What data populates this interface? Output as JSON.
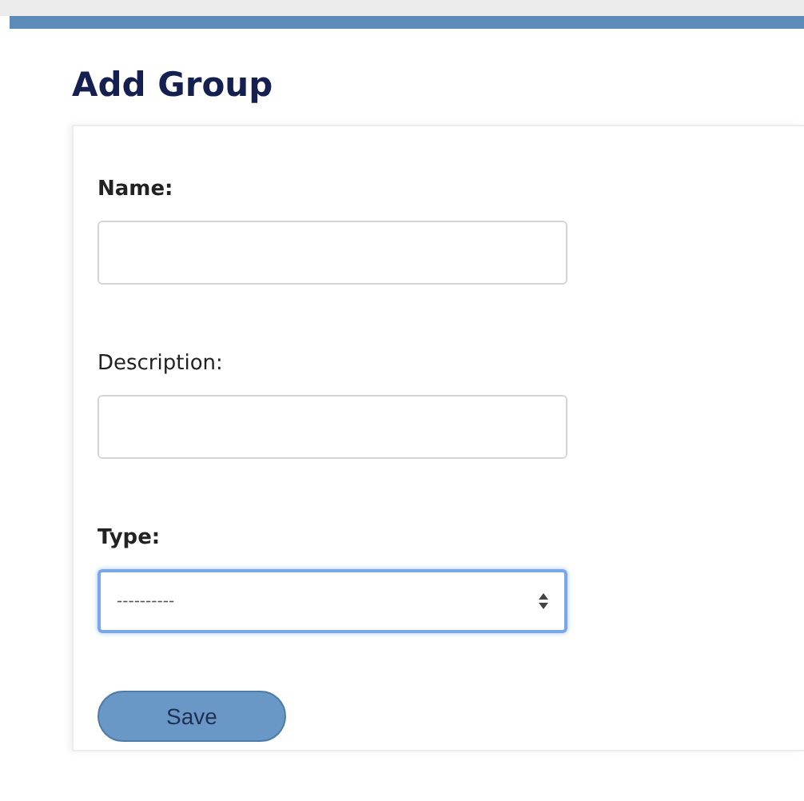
{
  "page": {
    "title": "Add Group"
  },
  "fields": [
    {
      "label": "Name:",
      "kind": "text",
      "required": true,
      "focused": false
    },
    {
      "label": "Description:",
      "kind": "text",
      "required": false,
      "focused": false
    },
    {
      "label": "Type:",
      "kind": "select",
      "required": true,
      "focused": true,
      "value": "----------"
    }
  ],
  "buttons": [
    "Save"
  ]
}
